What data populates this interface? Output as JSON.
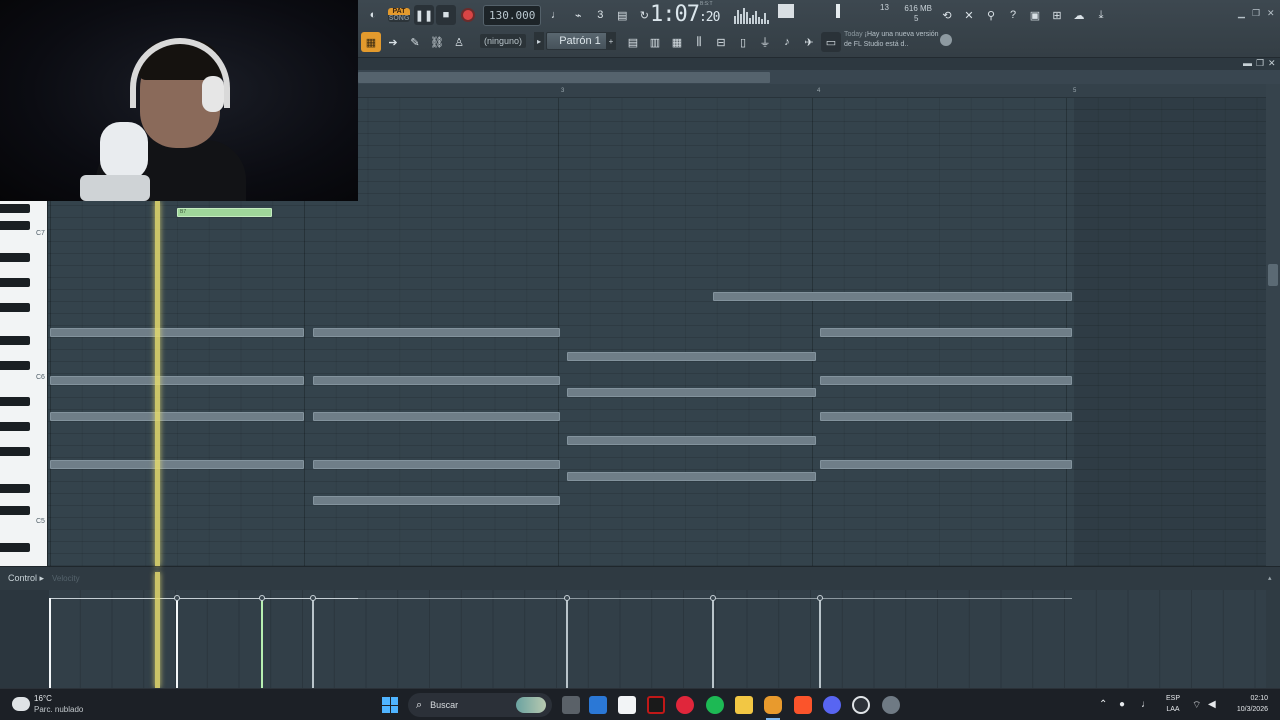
{
  "toolbar": {
    "pat_label": "PAT",
    "song_label": "SONG",
    "tempo": "130.000",
    "time_main": "1:07",
    "time_sub": ":20",
    "bst_label": "B:S:T",
    "cpu_percent": "13",
    "memory": "616 MB",
    "polyphony": "5",
    "pattern_none": "(ninguno)",
    "pattern_name": "Patrón 1",
    "hint_today": "Today",
    "hint_text": "¡Hay una nueva versión de FL Studio está d..",
    "accent_color": "#e39a2d"
  },
  "piano_roll": {
    "timeline_markers": [
      "3",
      "4",
      "5"
    ],
    "key_labels": [
      "C7",
      "C6",
      "C5"
    ],
    "active_note_label": "B7",
    "colors": {
      "note": "#6f7e88",
      "active_note": "#9fd69a",
      "playhead": "#e6dc6e"
    }
  },
  "event_editor": {
    "control_label": "Control",
    "control_arrow": "▸",
    "target_label": "Velocity"
  },
  "taskbar": {
    "weather_temp": "16°C",
    "weather_desc": "Parc. nublado",
    "search_label": "Buscar",
    "lang_top": "ESP",
    "lang_bottom": "LAA",
    "time": "02:10",
    "date": "10/3/2026"
  }
}
